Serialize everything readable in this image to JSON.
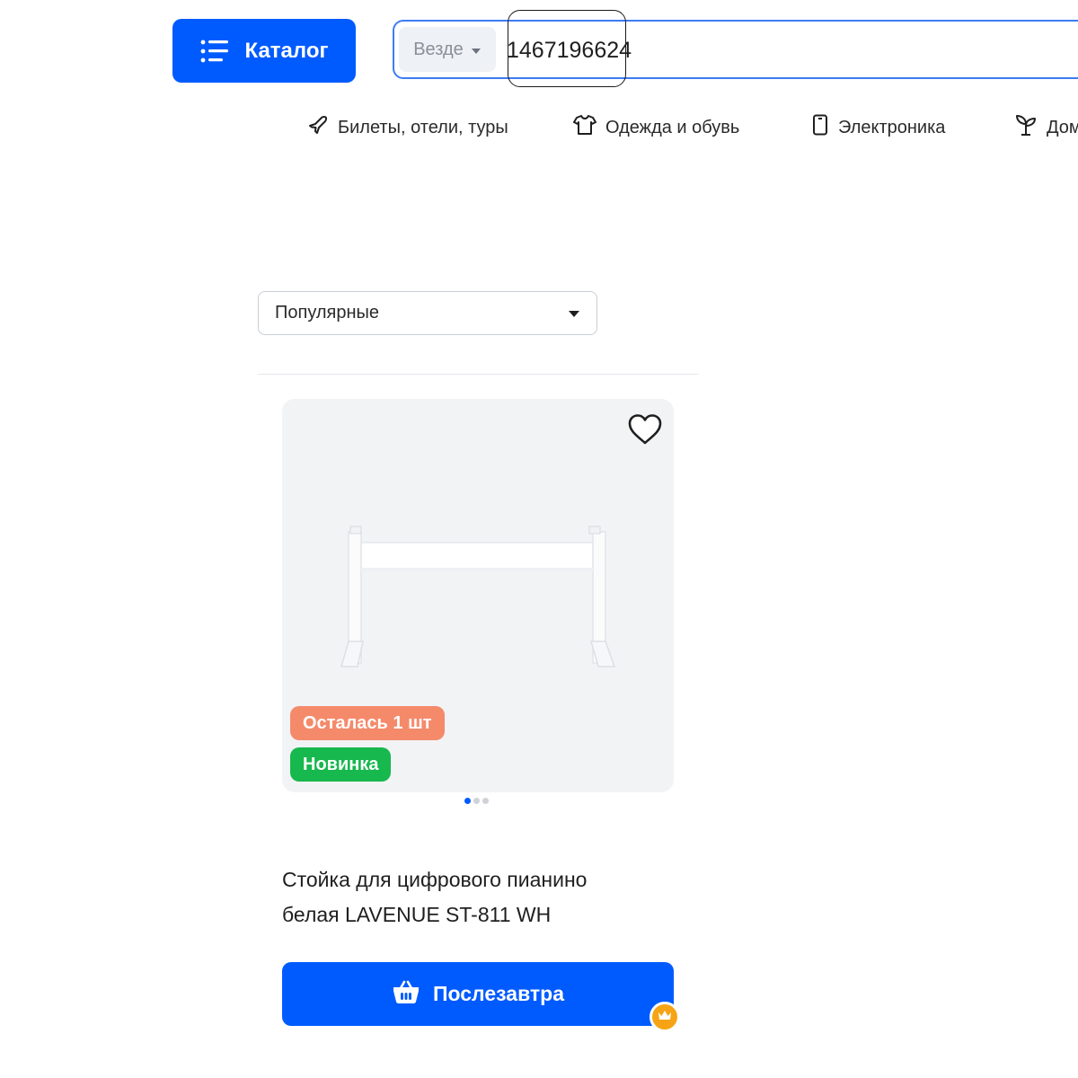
{
  "header": {
    "catalog_label": "Каталог",
    "search": {
      "scope_label": "Везде",
      "value": "1467196624"
    }
  },
  "nav": {
    "items": [
      {
        "label": "Билеты, отели, туры",
        "icon": "plane-icon"
      },
      {
        "label": "Одежда и обувь",
        "icon": "tshirt-icon"
      },
      {
        "label": "Электроника",
        "icon": "phone-icon"
      },
      {
        "label": "Дом",
        "icon": "plant-icon"
      }
    ]
  },
  "sort": {
    "selected": "Популярные"
  },
  "product": {
    "badges": {
      "stock": "Осталась 1 шт",
      "new": "Новинка"
    },
    "gallery": {
      "count": 3,
      "active": 1
    },
    "title_line1": "Стойка для цифрового пианино",
    "title_line2": "белая LAVENUE ST-811 WH",
    "buy_label": "Послезавтра"
  },
  "colors": {
    "accent": "#005bff",
    "badge_stock": "#f58a6b",
    "badge_new": "#17b84d",
    "premium": "#f6a415"
  }
}
